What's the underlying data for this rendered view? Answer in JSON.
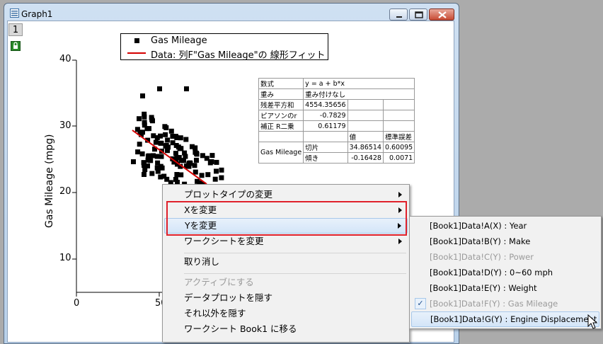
{
  "window": {
    "title": "Graph1"
  },
  "layer": {
    "tab": "1"
  },
  "legend": {
    "series_label": "Gas Mileage",
    "fit_label": "Data: 列F\"Gas Mileage\"の 線形フィット"
  },
  "axes": {
    "ylabel": "Gas Mileage (mpg)",
    "yticks": [
      "40",
      "30",
      "20",
      "10"
    ],
    "xticks": [
      "0",
      "50"
    ]
  },
  "fit_table": {
    "r1": [
      "数式",
      "y = a + b*x"
    ],
    "r2": [
      "重み",
      "重み付けなし"
    ],
    "r3": [
      "残差平方和",
      "4554.35656"
    ],
    "r4": [
      "ピアソンのr",
      "-0.7829"
    ],
    "r5": [
      "補正 R二乗",
      "0.61179"
    ],
    "head": [
      "値",
      "標準誤差"
    ],
    "group": "Gas Mileage",
    "r6": [
      "切片",
      "34.86514",
      "0.60095"
    ],
    "r7": [
      "傾き",
      "-0.16428",
      "0.0071"
    ]
  },
  "context_menu": {
    "items": [
      "プロットタイプの変更",
      "Xを変更",
      "Yを変更",
      "ワークシートを変更",
      "取り消し",
      "アクティブにする",
      "データプロットを隠す",
      "それ以外を隠す",
      "ワークシート Book1 に移る"
    ]
  },
  "submenu": {
    "items": [
      "[Book1]Data!A(X) : Year",
      "[Book1]Data!B(Y) : Make",
      "[Book1]Data!C(Y) : Power",
      "[Book1]Data!D(Y) : 0~60 mph",
      "[Book1]Data!E(Y) : Weight",
      "[Book1]Data!F(Y) : Gas Mileage",
      "[Book1]Data!G(Y) : Engine Displacement"
    ]
  },
  "colors": {
    "highlight_box": "#e0212b",
    "fit_line": "#d40000"
  }
}
